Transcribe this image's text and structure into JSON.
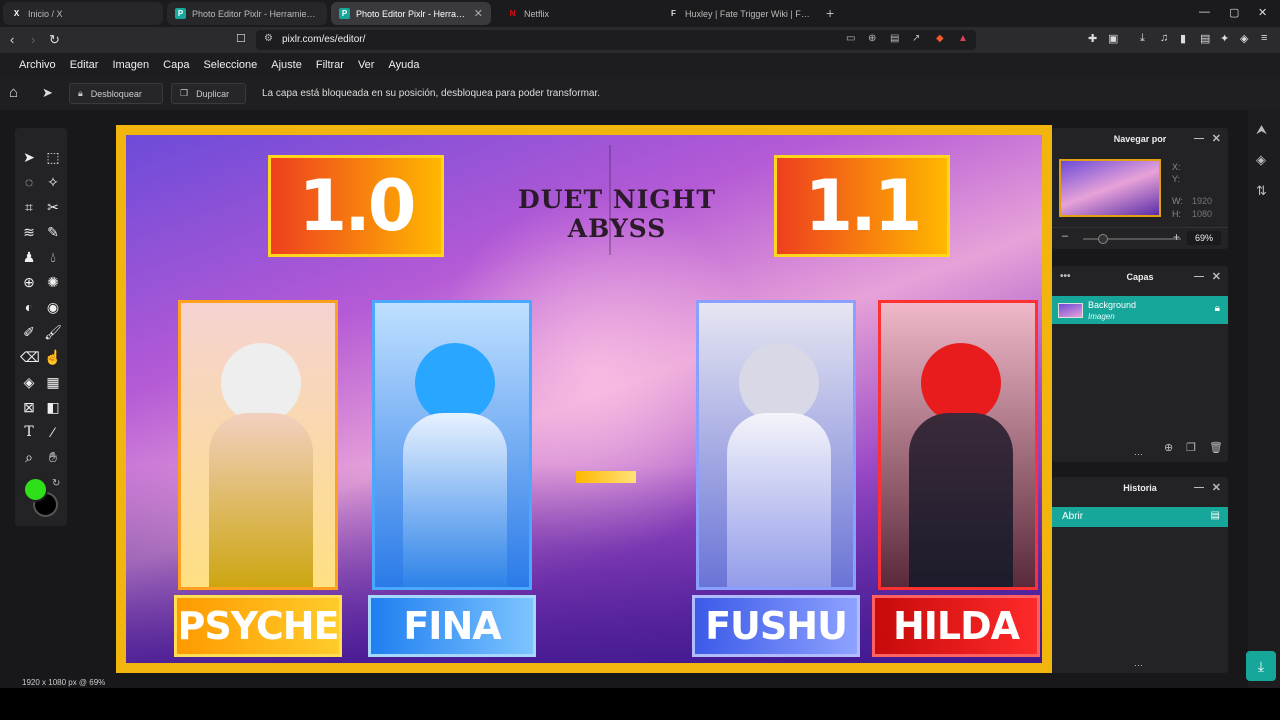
{
  "browser": {
    "tabs": [
      {
        "title": "Inicio / X",
        "favicon": "X",
        "active": false
      },
      {
        "title": "Photo Editor Pixlr - Herramienta avanzada",
        "favicon": "P",
        "active": false
      },
      {
        "title": "Photo Editor Pixlr - Herramienta",
        "favicon": "P",
        "active": true
      },
      {
        "title": "Netflix",
        "favicon": "N",
        "active": false
      },
      {
        "title": "Huxley | Fate Trigger Wiki | Fandom",
        "favicon": "F",
        "active": false
      }
    ],
    "url": "pixlr.com/es/editor/"
  },
  "menu": [
    "Archivo",
    "Editar",
    "Imagen",
    "Capa",
    "Seleccione",
    "Ajuste",
    "Filtrar",
    "Ver",
    "Ayuda"
  ],
  "options": {
    "unlock_label": "Desbloquear",
    "duplicate_label": "Duplicar",
    "message": "La capa está bloqueada en su posición, desbloquea para poder transformar."
  },
  "colors": {
    "foreground": "#2ee01a",
    "background": "#000000",
    "accent": "#16a69a"
  },
  "canvas": {
    "game_title": "DUET NIGHT ABYSS",
    "versions": [
      "1.0",
      "1.1"
    ],
    "characters": [
      "PSYCHE",
      "FINA",
      "FUSHU",
      "HILDA"
    ]
  },
  "status": "1920 x 1080 px @ 69%",
  "navigator": {
    "title": "Navegar por",
    "x_label": "X:",
    "y_label": "Y:",
    "w_label": "W:",
    "w_value": "1920",
    "h_label": "H:",
    "h_value": "1080",
    "zoom": "69%",
    "minus": "–",
    "plus": "+"
  },
  "layers": {
    "title": "Capas",
    "items": [
      {
        "name": "Background",
        "type": "Imagen"
      }
    ]
  },
  "history": {
    "title": "Historia",
    "items": [
      "Abrir"
    ]
  }
}
